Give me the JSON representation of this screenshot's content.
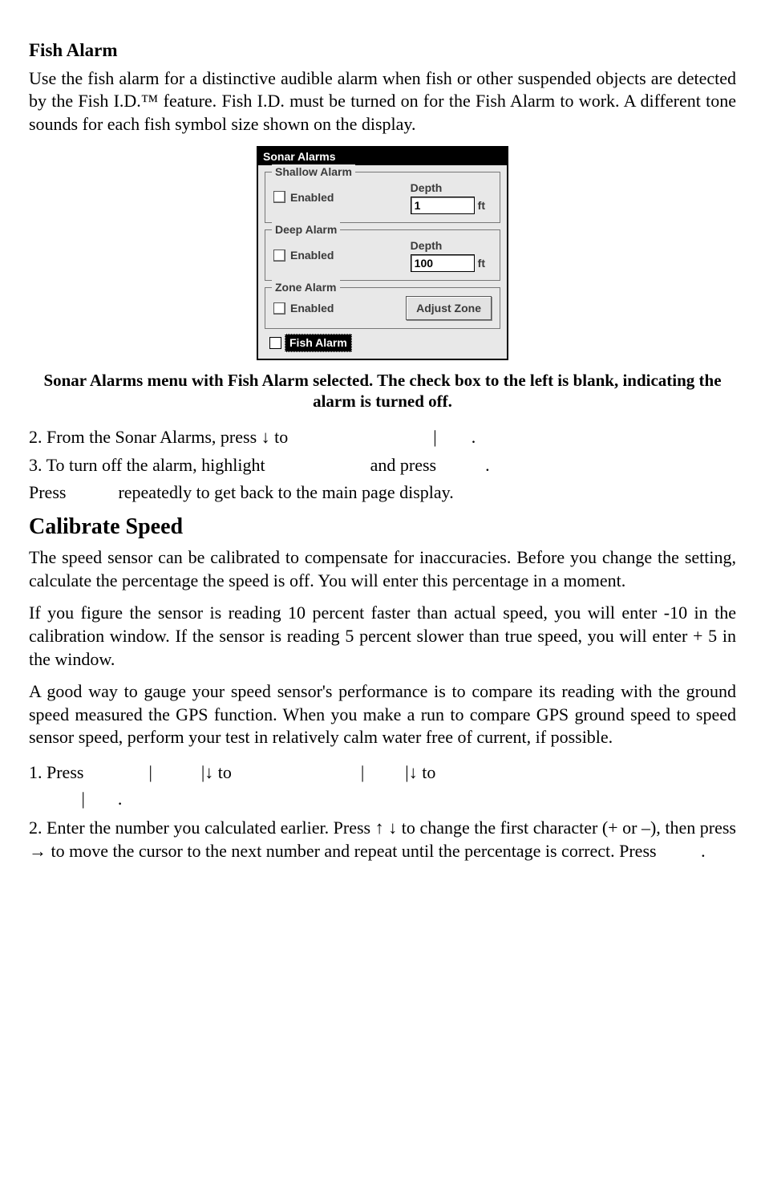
{
  "heading_fish_alarm": "Fish Alarm",
  "para_fish_alarm": "Use the fish alarm for a distinctive audible alarm when fish or other suspended objects are detected by the Fish I.D.™ feature. Fish I.D. must be turned on for the Fish Alarm to work. A different tone sounds for each fish symbol size shown on the display.",
  "dialog": {
    "title": "Sonar Alarms",
    "shallow": {
      "group": "Shallow Alarm",
      "enabled_label": "Enabled",
      "depth_label": "Depth",
      "depth_value": "1",
      "unit": "ft"
    },
    "deep": {
      "group": "Deep Alarm",
      "enabled_label": "Enabled",
      "depth_label": "Depth",
      "depth_value": "100",
      "unit": "ft"
    },
    "zone": {
      "group": "Zone Alarm",
      "enabled_label": "Enabled",
      "button": "Adjust Zone"
    },
    "fish": {
      "label": "Fish Alarm"
    }
  },
  "caption": "Sonar Alarms menu with Fish Alarm selected. The check box to the left is blank, indicating the alarm is turned off.",
  "step2_a": "2. From the Sonar Alarms, press ",
  "step2_b": " to ",
  "step2_c": "|",
  "step2_d": ".",
  "step3_a": "3. To turn off the alarm, highlight ",
  "step3_b": "and press",
  "step3_c": ".",
  "press_line_a": "Press",
  "press_line_b": "repeatedly to get back to the main page display.",
  "heading_calibrate": "Calibrate Speed",
  "para_cal1": "The speed sensor can be calibrated to compensate for inaccuracies. Before you change the setting, calculate the percentage the speed is off. You will enter this percentage in a moment.",
  "para_cal2": "If you figure the sensor is reading 10 percent faster than actual speed, you will enter -10 in the calibration window. If the sensor is reading 5 percent slower than true speed, you will enter + 5 in the window.",
  "para_cal3": "A good way to gauge your speed sensor's performance is to compare its reading with the ground speed measured the GPS function. When you make a run to compare GPS ground speed to speed sensor speed, perform your test in relatively calm water free of current, if possible.",
  "step_cal1_a": "1.  Press",
  "step_cal1_b": "|",
  "step_cal1_c": "|",
  "step_cal1_d": " to ",
  "step_cal1_e": "|",
  "step_cal1_f": "|",
  "step_cal1_g": " to ",
  "step_cal1_h": "|",
  "step_cal1_i": ".",
  "step_cal2_a": "2. Enter the number you calculated earlier. Press ",
  "step_cal2_b": " to change the first character (+ or –), then press ",
  "step_cal2_c": " to move the cursor to the next number and repeat until the percentage is correct. Press",
  "step_cal2_d": ".",
  "arrows": {
    "down": "↓",
    "up": "↑",
    "right": "→"
  }
}
